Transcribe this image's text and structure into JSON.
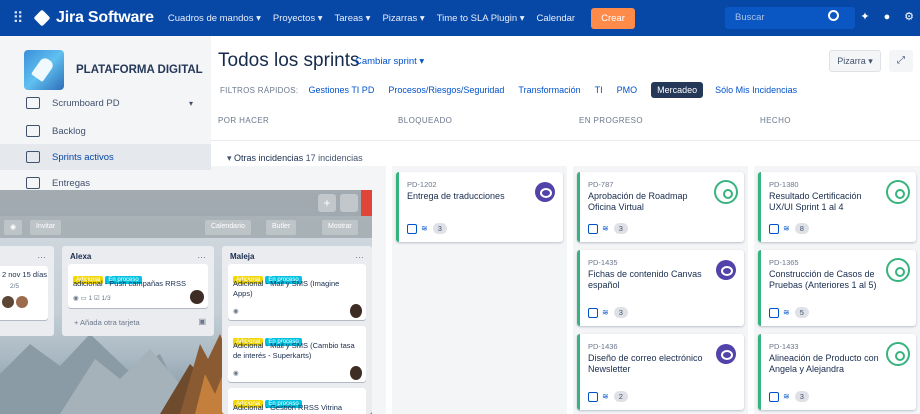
{
  "jira": {
    "app_name": "Jira Software",
    "nav": [
      "Cuadros de mandos ▾",
      "Proyectos ▾",
      "Tareas ▾",
      "Pizarras ▾",
      "Time to SLA Plugin ▾",
      "Calendar"
    ],
    "create_label": "Crear",
    "search_placeholder": "Buscar",
    "project_name": "PLATAFORMA DIGITAL",
    "sidebar": [
      {
        "label": "Scrumboard PD"
      },
      {
        "label": "Backlog"
      },
      {
        "label": "Sprints activos"
      },
      {
        "label": "Entregas"
      }
    ],
    "page_title": "Todos los sprints",
    "change_sprint": "Cambiar sprint ▾",
    "board_button": "Pizarra ▾",
    "quick_filters_label": "FILTROS RÁPIDOS:",
    "quick_filters": [
      "Gestiones TI PD",
      "Procesos/Riesgos/Seguridad",
      "Transformación",
      "TI",
      "PMO",
      "Mercadeo",
      "Sólo Mis Incidencias"
    ],
    "selected_filter": "Mercadeo",
    "columns": [
      "POR HACER",
      "BLOQUEADO",
      "EN PROGRESO",
      "HECHO"
    ],
    "swimlane": {
      "toggle": "▾",
      "name": "Otras incidencias",
      "count": "17 incidencias"
    },
    "cards": [
      {
        "key": "PD-1202",
        "summary": "Entrega de traducciones",
        "estimate": "3",
        "avatar": "purple"
      },
      {
        "key": "PD-787",
        "summary": "Aprobación de Roadmap Oficina Virtual",
        "estimate": "3",
        "avatar": "green"
      },
      {
        "key": "PD-1435",
        "summary": "Fichas de contenido Canvas español",
        "estimate": "3",
        "avatar": "purple"
      },
      {
        "key": "PD-1436",
        "summary": "Diseño de correo electrónico Newsletter",
        "estimate": "2",
        "avatar": "purple"
      },
      {
        "key": "PD-1380",
        "summary": "Resultado Certificación UX/UI Sprint 1 al 4",
        "estimate": "8",
        "avatar": "green"
      },
      {
        "key": "PD-1365",
        "summary": "Construcción de Casos de Pruebas (Anteriores 1 al 5)",
        "estimate": "5",
        "avatar": "green"
      },
      {
        "key": "PD-1433",
        "summary": "Alineación de Producto con Angela y Alejandra",
        "estimate": "3",
        "avatar": "green"
      }
    ],
    "colors": {
      "nav": "#0747a6",
      "accent": "#0052cc",
      "done_border": "#36b37e",
      "create": "#ff8b4a"
    }
  },
  "trello": {
    "invite": "Invitar",
    "calendar": "Calendario",
    "butler": "Butler",
    "show_menu": "Mostrar",
    "lists": [
      {
        "name": "",
        "card_text": "2 nov 15 días",
        "checklist": "2/5"
      },
      {
        "name": "Alexa",
        "card_labels": [
          "Adicional",
          "En proceso"
        ],
        "card_text": "adicional - Push campañas RRSS",
        "comments": "1",
        "checklist": "1/3",
        "add_card": "+ Añada otra tarjeta"
      },
      {
        "name": "Maleja",
        "cards": [
          {
            "labels": [
              "Adicional",
              "En proceso"
            ],
            "text": "Adicional - Mail y SMS (Imagine Apps)"
          },
          {
            "labels": [
              "Adicional",
              "En proceso"
            ],
            "text": "Adicional - Mail y SMS (Cambio tasa de interés - Superkarts)"
          },
          {
            "labels": [
              "Adicional",
              "En proceso"
            ],
            "text": "Adicional - Gestión RRSS Vitrina"
          }
        ]
      }
    ]
  }
}
